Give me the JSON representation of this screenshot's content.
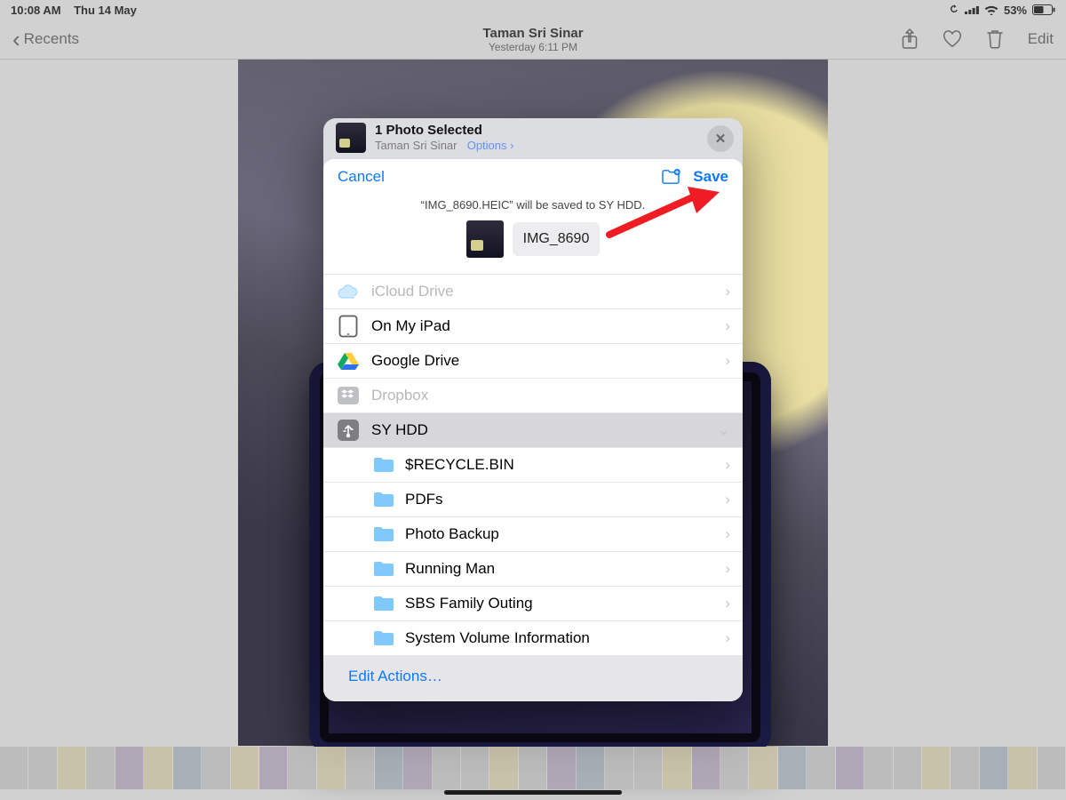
{
  "status_bar": {
    "time": "10:08 AM",
    "date": "Thu 14 May",
    "battery_pct": "53%"
  },
  "nav": {
    "back_label": "Recents",
    "title": "Taman Sri Sinar",
    "subtitle": "Yesterday  6:11 PM",
    "edit_label": "Edit"
  },
  "share_header": {
    "title": "1 Photo Selected",
    "subtitle": "Taman Sri Sinar",
    "options_label": "Options",
    "options_chevron": "›"
  },
  "save_panel": {
    "cancel_label": "Cancel",
    "save_label": "Save",
    "message": "“IMG_8690.HEIC” will be saved to SY HDD.",
    "filename": "IMG_8690"
  },
  "locations": {
    "icloud": "iCloud Drive",
    "on_ipad": "On My iPad",
    "gdrive": "Google Drive",
    "dropbox": "Dropbox",
    "syhdd": "SY HDD"
  },
  "syhdd_folders": [
    "$RECYCLE.BIN",
    "PDFs",
    "Photo Backup",
    "Running Man",
    "SBS Family Outing",
    "System Volume Information"
  ],
  "edit_actions_label": "Edit Actions…",
  "glyphs": {
    "chevron_right": "›",
    "chevron_left": "‹",
    "chevron_down": "⌄",
    "close_x": "✕"
  }
}
